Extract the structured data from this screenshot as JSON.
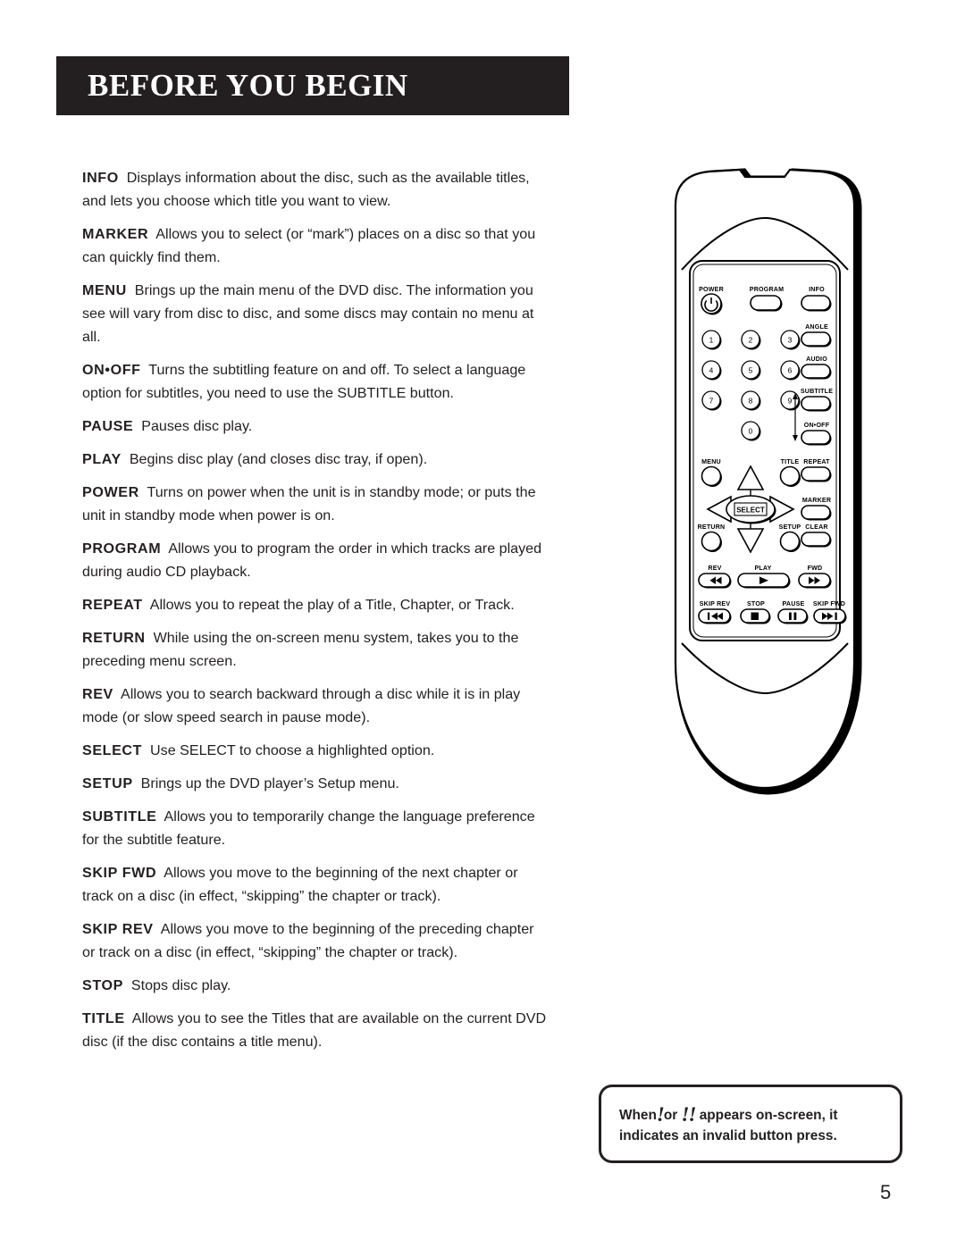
{
  "header": {
    "title": "BEFORE YOU BEGIN"
  },
  "page": {
    "number": "5"
  },
  "entries": [
    {
      "term": "INFO",
      "text": "Displays information about the disc, such as the available titles, and lets you choose which title you want to view."
    },
    {
      "term": "MARKER",
      "text": "Allows you to select (or “mark”) places on a disc so that you can quickly find them."
    },
    {
      "term": "MENU",
      "text": "Brings up the main menu of the DVD disc. The information you see will vary from disc to disc, and some discs may contain no menu at all."
    },
    {
      "term": "ON•OFF",
      "text": "Turns the subtitling feature on and off. To select a language option for subtitles, you need to use the SUBTITLE button."
    },
    {
      "term": "PAUSE",
      "text": "Pauses disc play."
    },
    {
      "term": "PLAY",
      "text": "Begins disc play (and closes disc tray, if open)."
    },
    {
      "term": "POWER",
      "text": "Turns on power when the unit is in standby mode; or puts the unit in standby mode when power is on."
    },
    {
      "term": "PROGRAM",
      "text": "Allows you to program the order in which tracks are played during audio CD playback."
    },
    {
      "term": "REPEAT",
      "text": "Allows you to repeat the play of a Title, Chapter, or Track."
    },
    {
      "term": "RETURN",
      "text": "While using the on-screen menu system, takes you to the preceding menu screen."
    },
    {
      "term": "REV",
      "text": "Allows you to search backward through a disc while it is in play mode (or slow speed search in pause mode)."
    },
    {
      "term": "SELECT",
      "text": "Use SELECT to choose a highlighted option."
    },
    {
      "term": "SETUP",
      "text": "Brings up the DVD player’s Setup menu."
    },
    {
      "term": "SUBTITLE",
      "text": "Allows you to temporarily change the language preference for the subtitle feature."
    },
    {
      "term": "SKIP FWD",
      "text": "Allows you move to the beginning of the next chapter or track on a disc (in effect, “skipping” the chapter or track)."
    },
    {
      "term": "SKIP REV",
      "text": "Allows you move to the beginning of the preceding chapter or track on a disc (in effect, “skipping” the chapter or track)."
    },
    {
      "term": "STOP",
      "text": "Stops disc play."
    },
    {
      "term": "TITLE",
      "text": "Allows you to see the Titles that are available on the current DVD disc (if the disc contains a title menu)."
    }
  ],
  "remote": {
    "labels": {
      "power": "POWER",
      "program": "PROGRAM",
      "info": "INFO",
      "angle": "ANGLE",
      "audio": "AUDIO",
      "subtitle": "SUBTITLE",
      "onoff": "ON•OFF",
      "menu": "MENU",
      "title": "TITLE",
      "repeat": "REPEAT",
      "marker": "MARKER",
      "return": "RETURN",
      "setup": "SETUP",
      "clear": "CLEAR",
      "select": "SELECT",
      "rev": "REV",
      "play": "PLAY",
      "fwd": "FWD",
      "skip_rev": "SKIP REV",
      "stop": "STOP",
      "pause": "PAUSE",
      "skip_fwd": "SKIP FWD"
    },
    "keypad": [
      "1",
      "2",
      "3",
      "4",
      "5",
      "6",
      "7",
      "8",
      "9",
      "0"
    ]
  },
  "note": {
    "before": "When",
    "bang1": "!",
    "middle": "or",
    "bang2": "!!",
    "after": "appears on-screen, it indicates an invalid button press."
  }
}
